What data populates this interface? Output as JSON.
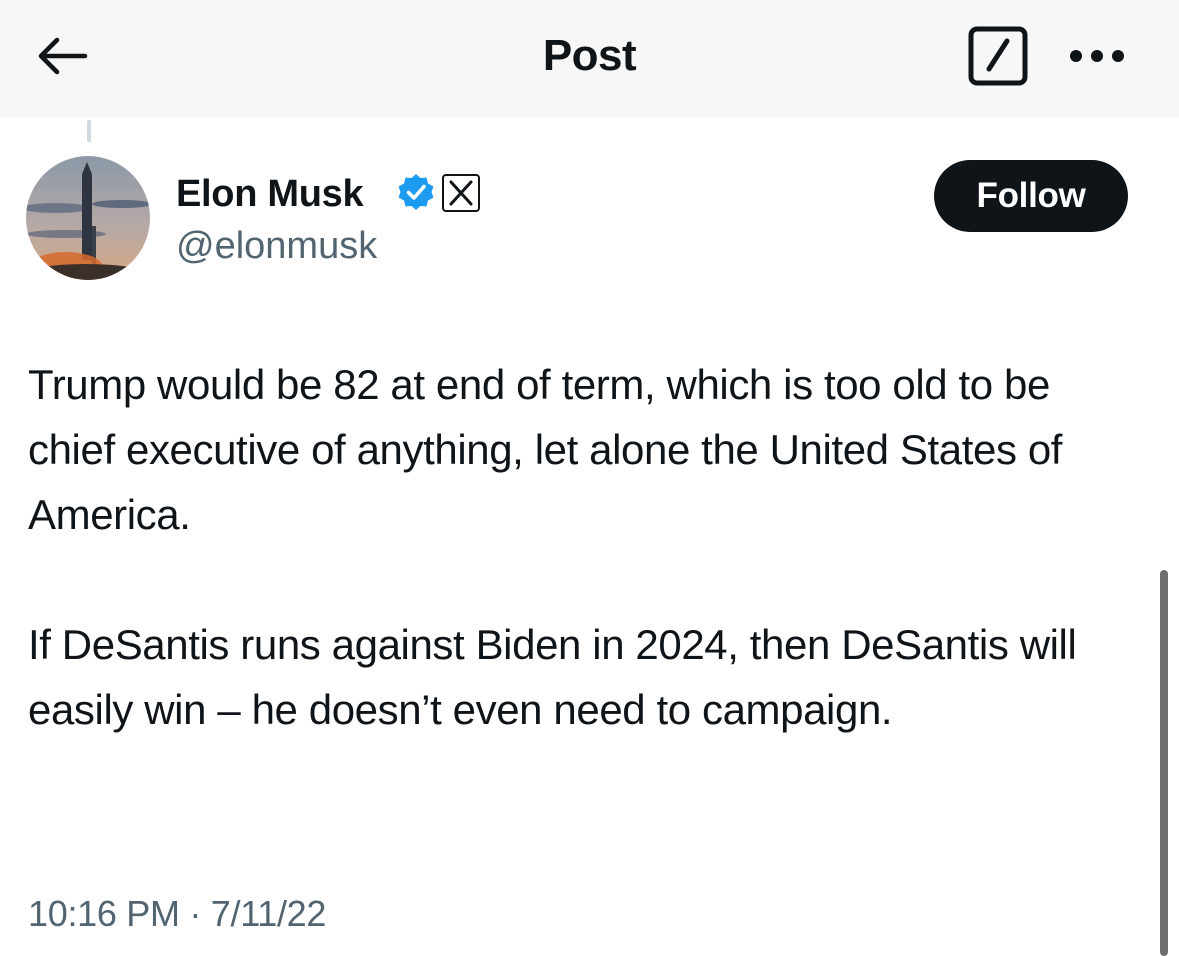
{
  "header": {
    "title": "Post",
    "back_icon": "arrow-left-icon",
    "edit_icon": "compose-icon",
    "more_icon": "more-horizontal-icon"
  },
  "author": {
    "name": "Elon Musk",
    "handle": "@elonmusk",
    "verified_icon": "verified-badge-icon",
    "affiliation_icon": "x-logo-icon",
    "verified_color": "#1d9bf0"
  },
  "follow_button": {
    "label": "Follow"
  },
  "post": {
    "paragraphs": [
      "Trump would be 82 at end of term, which is too old to be chief executive of anything, let alone the United States of America.",
      "If DeSantis runs against Biden in 2024, then DeSantis will easily win – he doesn’t even need to campaign."
    ],
    "timestamp": "10:16 PM · 7/11/22"
  }
}
